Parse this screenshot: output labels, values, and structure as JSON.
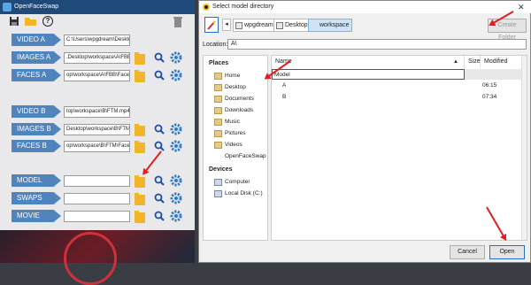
{
  "left_window": {
    "title": "OpenFaceSwap",
    "rows": [
      {
        "label": "VIDEO A",
        "path": "C:\\Users\\wpgdream\\Deskto"
      },
      {
        "label": "IMAGES A",
        "path": ".Desktop\\workspace\\A\\FBB"
      },
      {
        "label": "FACES A",
        "path": "op\\workspace\\A\\FBB\\Face"
      },
      {
        "label": "VIDEO B",
        "path": "top\\workspace\\B\\FTM.mp4"
      },
      {
        "label": "IMAGES B",
        "path": "Desktop\\workspace\\B\\FTM"
      },
      {
        "label": "FACES B",
        "path": "op\\workspace\\B\\FTM\\Face"
      },
      {
        "label": "MODEL",
        "path": ""
      },
      {
        "label": "SWAPS",
        "path": ""
      },
      {
        "label": "MOVIE",
        "path": ""
      }
    ],
    "toolbar_icons": [
      "save-icon",
      "open-folder-icon",
      "help-icon",
      "trash-icon"
    ],
    "help_glyph": "?"
  },
  "dialog": {
    "title": "Select model directory",
    "close_glyph": "✕",
    "back_glyph": "◂",
    "breadcrumbs": [
      "wpgdream",
      "Desktop",
      "workspace"
    ],
    "create_folder_label": "Create Folder",
    "location_label": "Location:",
    "location_value": "A\\",
    "places_header": "Places",
    "places": [
      "Home",
      "Desktop",
      "Documents",
      "Downloads",
      "Music",
      "Pictures",
      "Videos",
      "OpenFaceSwap"
    ],
    "devices_header": "Devices",
    "devices": [
      "Computer",
      "Local Disk (C:)"
    ],
    "columns": {
      "name": "Name",
      "size": "Size",
      "modified": "Modified",
      "sort_glyph": "▲"
    },
    "edit_value": "Model",
    "files": [
      {
        "name": "A",
        "size": "",
        "modified": "06:15"
      },
      {
        "name": "B",
        "size": "",
        "modified": "07:34"
      }
    ],
    "cancel_label": "Cancel",
    "open_label": "Open"
  },
  "colors": {
    "accent_blue": "#4f84bd",
    "title_bar": "#1f4a7a",
    "folder_yellow": "#f1b52c",
    "annotation_red": "#e02020"
  }
}
